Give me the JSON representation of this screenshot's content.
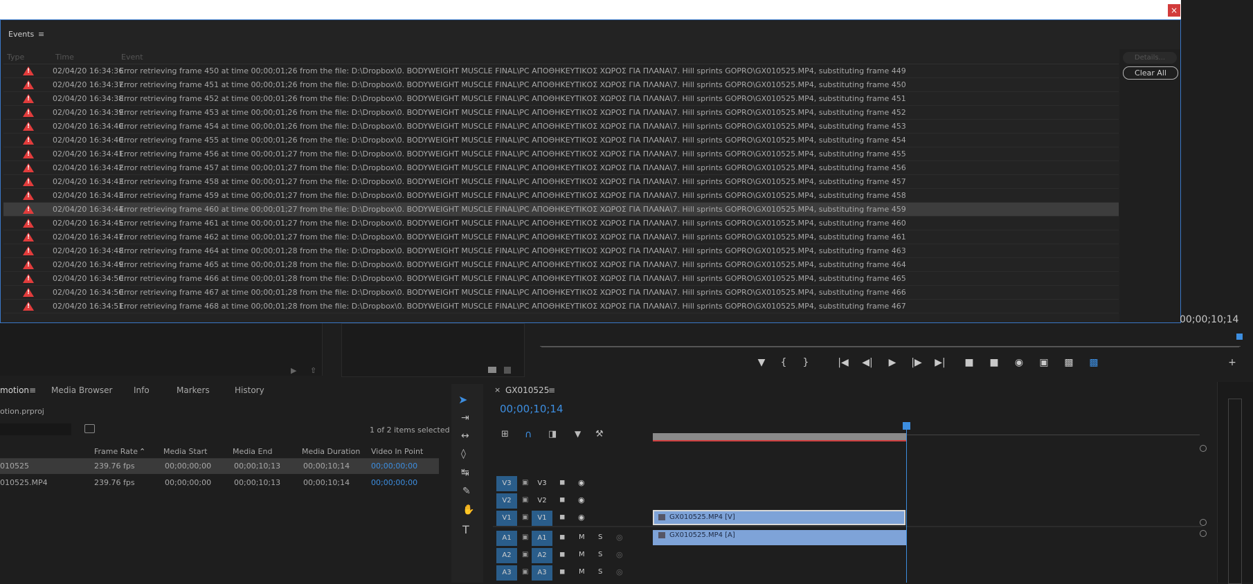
{
  "events_panel": {
    "title": "Events",
    "menu_icon": "hamburger-icon",
    "close_icon": "close-icon",
    "columns": [
      "Type",
      "Time",
      "Event"
    ],
    "buttons": {
      "details": "Details...",
      "clear_all": "Clear All"
    },
    "rows": [
      {
        "time": "02/04/20 16:34:36",
        "event": "Error retrieving frame 450 at time 00;00;01;26 from the file: D:\\Dropbox\\0. BODYWEIGHT MUSCLE FINAL\\PC ΑΠΟΘΗΚΕΥΤΙΚΟΣ ΧΩΡΟΣ ΓΙΑ ΠΛΑΝΑ\\7. Hill sprints GOPRO\\GX010525.MP4, substituting frame 449"
      },
      {
        "time": "02/04/20 16:34:37",
        "event": "Error retrieving frame 451 at time 00;00;01;26 from the file: D:\\Dropbox\\0. BODYWEIGHT MUSCLE FINAL\\PC ΑΠΟΘΗΚΕΥΤΙΚΟΣ ΧΩΡΟΣ ΓΙΑ ΠΛΑΝΑ\\7. Hill sprints GOPRO\\GX010525.MP4, substituting frame 450"
      },
      {
        "time": "02/04/20 16:34:38",
        "event": "Error retrieving frame 452 at time 00;00;01;26 from the file: D:\\Dropbox\\0. BODYWEIGHT MUSCLE FINAL\\PC ΑΠΟΘΗΚΕΥΤΙΚΟΣ ΧΩΡΟΣ ΓΙΑ ΠΛΑΝΑ\\7. Hill sprints GOPRO\\GX010525.MP4, substituting frame 451"
      },
      {
        "time": "02/04/20 16:34:39",
        "event": "Error retrieving frame 453 at time 00;00;01;26 from the file: D:\\Dropbox\\0. BODYWEIGHT MUSCLE FINAL\\PC ΑΠΟΘΗΚΕΥΤΙΚΟΣ ΧΩΡΟΣ ΓΙΑ ΠΛΑΝΑ\\7. Hill sprints GOPRO\\GX010525.MP4, substituting frame 452"
      },
      {
        "time": "02/04/20 16:34:40",
        "event": "Error retrieving frame 454 at time 00;00;01;26 from the file: D:\\Dropbox\\0. BODYWEIGHT MUSCLE FINAL\\PC ΑΠΟΘΗΚΕΥΤΙΚΟΣ ΧΩΡΟΣ ΓΙΑ ΠΛΑΝΑ\\7. Hill sprints GOPRO\\GX010525.MP4, substituting frame 453"
      },
      {
        "time": "02/04/20 16:34:40",
        "event": "Error retrieving frame 455 at time 00;00;01;26 from the file: D:\\Dropbox\\0. BODYWEIGHT MUSCLE FINAL\\PC ΑΠΟΘΗΚΕΥΤΙΚΟΣ ΧΩΡΟΣ ΓΙΑ ΠΛΑΝΑ\\7. Hill sprints GOPRO\\GX010525.MP4, substituting frame 454"
      },
      {
        "time": "02/04/20 16:34:41",
        "event": "Error retrieving frame 456 at time 00;00;01;27 from the file: D:\\Dropbox\\0. BODYWEIGHT MUSCLE FINAL\\PC ΑΠΟΘΗΚΕΥΤΙΚΟΣ ΧΩΡΟΣ ΓΙΑ ΠΛΑΝΑ\\7. Hill sprints GOPRO\\GX010525.MP4, substituting frame 455"
      },
      {
        "time": "02/04/20 16:34:42",
        "event": "Error retrieving frame 457 at time 00;00;01;27 from the file: D:\\Dropbox\\0. BODYWEIGHT MUSCLE FINAL\\PC ΑΠΟΘΗΚΕΥΤΙΚΟΣ ΧΩΡΟΣ ΓΙΑ ΠΛΑΝΑ\\7. Hill sprints GOPRO\\GX010525.MP4, substituting frame 456"
      },
      {
        "time": "02/04/20 16:34:43",
        "event": "Error retrieving frame 458 at time 00;00;01;27 from the file: D:\\Dropbox\\0. BODYWEIGHT MUSCLE FINAL\\PC ΑΠΟΘΗΚΕΥΤΙΚΟΣ ΧΩΡΟΣ ΓΙΑ ΠΛΑΝΑ\\7. Hill sprints GOPRO\\GX010525.MP4, substituting frame 457"
      },
      {
        "time": "02/04/20 16:34:43",
        "event": "Error retrieving frame 459 at time 00;00;01;27 from the file: D:\\Dropbox\\0. BODYWEIGHT MUSCLE FINAL\\PC ΑΠΟΘΗΚΕΥΤΙΚΟΣ ΧΩΡΟΣ ΓΙΑ ΠΛΑΝΑ\\7. Hill sprints GOPRO\\GX010525.MP4, substituting frame 458"
      },
      {
        "time": "02/04/20 16:34:44",
        "event": "Error retrieving frame 460 at time 00;00;01;27 from the file: D:\\Dropbox\\0. BODYWEIGHT MUSCLE FINAL\\PC ΑΠΟΘΗΚΕΥΤΙΚΟΣ ΧΩΡΟΣ ΓΙΑ ΠΛΑΝΑ\\7. Hill sprints GOPRO\\GX010525.MP4, substituting frame 459",
        "selected": true
      },
      {
        "time": "02/04/20 16:34:45",
        "event": "Error retrieving frame 461 at time 00;00;01;27 from the file: D:\\Dropbox\\0. BODYWEIGHT MUSCLE FINAL\\PC ΑΠΟΘΗΚΕΥΤΙΚΟΣ ΧΩΡΟΣ ΓΙΑ ΠΛΑΝΑ\\7. Hill sprints GOPRO\\GX010525.MP4, substituting frame 460"
      },
      {
        "time": "02/04/20 16:34:47",
        "event": "Error retrieving frame 462 at time 00;00;01;27 from the file: D:\\Dropbox\\0. BODYWEIGHT MUSCLE FINAL\\PC ΑΠΟΘΗΚΕΥΤΙΚΟΣ ΧΩΡΟΣ ΓΙΑ ΠΛΑΝΑ\\7. Hill sprints GOPRO\\GX010525.MP4, substituting frame 461"
      },
      {
        "time": "02/04/20 16:34:48",
        "event": "Error retrieving frame 464 at time 00;00;01;28 from the file: D:\\Dropbox\\0. BODYWEIGHT MUSCLE FINAL\\PC ΑΠΟΘΗΚΕΥΤΙΚΟΣ ΧΩΡΟΣ ΓΙΑ ΠΛΑΝΑ\\7. Hill sprints GOPRO\\GX010525.MP4, substituting frame 463"
      },
      {
        "time": "02/04/20 16:34:49",
        "event": "Error retrieving frame 465 at time 00;00;01;28 from the file: D:\\Dropbox\\0. BODYWEIGHT MUSCLE FINAL\\PC ΑΠΟΘΗΚΕΥΤΙΚΟΣ ΧΩΡΟΣ ΓΙΑ ΠΛΑΝΑ\\7. Hill sprints GOPRO\\GX010525.MP4, substituting frame 464"
      },
      {
        "time": "02/04/20 16:34:50",
        "event": "Error retrieving frame 466 at time 00;00;01;28 from the file: D:\\Dropbox\\0. BODYWEIGHT MUSCLE FINAL\\PC ΑΠΟΘΗΚΕΥΤΙΚΟΣ ΧΩΡΟΣ ΓΙΑ ΠΛΑΝΑ\\7. Hill sprints GOPRO\\GX010525.MP4, substituting frame 465"
      },
      {
        "time": "02/04/20 16:34:50",
        "event": "Error retrieving frame 467 at time 00;00;01;28 from the file: D:\\Dropbox\\0. BODYWEIGHT MUSCLE FINAL\\PC ΑΠΟΘΗΚΕΥΤΙΚΟΣ ΧΩΡΟΣ ΓΙΑ ΠΛΑΝΑ\\7. Hill sprints GOPRO\\GX010525.MP4, substituting frame 466"
      },
      {
        "time": "02/04/20 16:34:51",
        "event": "Error retrieving frame 468 at time 00;00;01;28 from the file: D:\\Dropbox\\0. BODYWEIGHT MUSCLE FINAL\\PC ΑΠΟΘΗΚΕΥΤΙΚΟΣ ΧΩΡΟΣ ΓΙΑ ΠΛΑΝΑ\\7. Hill sprints GOPRO\\GX010525.MP4, substituting frame 467"
      }
    ]
  },
  "program_monitor": {
    "timecode": "00;00;10;14"
  },
  "project_panel": {
    "tabs": [
      "motion",
      "Media Browser",
      "Info",
      "Markers",
      "History"
    ],
    "project_file": "otion.prproj",
    "items_selected": "1 of 2 items selected",
    "columns": [
      "Frame Rate",
      "Media Start",
      "Media End",
      "Media Duration",
      "Video In Point"
    ],
    "rows": [
      {
        "name": "010525",
        "frame_rate": "239.76 fps",
        "media_start": "00;00;00;00",
        "media_end": "00;00;10;13",
        "media_duration": "00;00;10;14",
        "video_in": "00;00;00;00"
      },
      {
        "name": "010525.MP4",
        "frame_rate": "239.76 fps",
        "media_start": "00;00;00;00",
        "media_end": "00;00;10;13",
        "media_duration": "00;00;10;14",
        "video_in": "00;00;00;00"
      }
    ]
  },
  "timeline": {
    "sequence_name": "GX010525",
    "timecode": "00;00;10;14",
    "tracks_video": [
      "V3",
      "V2",
      "V1"
    ],
    "tracks_audio": [
      "A1",
      "A2",
      "A3"
    ],
    "video_clip": "GX010525.MP4 [V]",
    "audio_clip": "GX010525.MP4 [A]",
    "mute_label": "M",
    "solo_label": "S"
  }
}
